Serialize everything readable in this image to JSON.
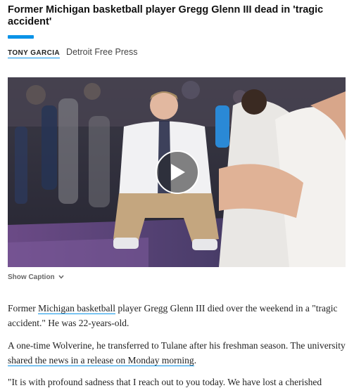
{
  "article": {
    "headline": "Former Michigan basketball player Gregg Glenn III dead in 'tragic accident'",
    "author": "TONY GARCIA",
    "publisher": "Detroit Free Press",
    "accent_color": "#0a93e8"
  },
  "media": {
    "type": "video",
    "play_icon": "play-icon",
    "show_caption_label": "Show Caption",
    "caption_icon": "chevron-down-icon"
  },
  "body": {
    "p1": {
      "before": "Former ",
      "link": "Michigan basketball",
      "after": " player Gregg Glenn III died over the weekend in a \"tragic accident.\" He was 22-years-old."
    },
    "p2": {
      "before": "A one-time Wolverine, he transferred to Tulane after his freshman season. The university ",
      "link": "shared the news in a release on Monday morning",
      "after": "."
    },
    "p3": {
      "text": "\"It is with profound sadness that I reach out to you today. We have lost a cherished"
    }
  }
}
